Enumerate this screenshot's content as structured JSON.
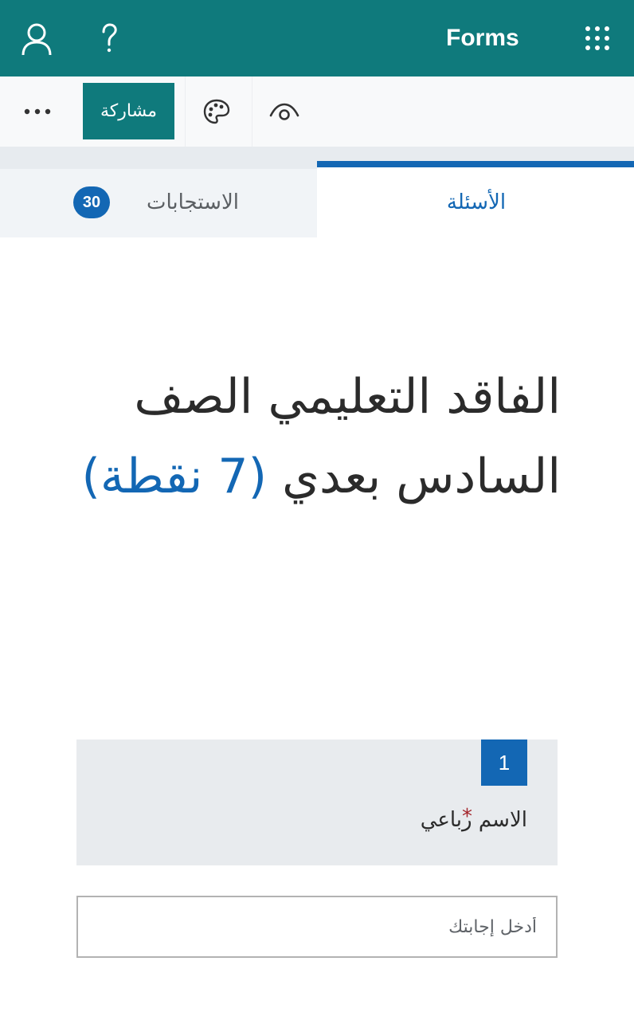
{
  "appbar": {
    "title": "Forms",
    "bg_color": "#0f7a7c",
    "icons": [
      "user-icon",
      "help-icon",
      "waffle-icon"
    ]
  },
  "toolbar": {
    "share_label": "مشاركة",
    "icons": [
      "more-icon",
      "palette-icon",
      "eye-icon"
    ]
  },
  "tabs": {
    "questions_label": "الأسئلة",
    "responses_label": "الاستجابات",
    "responses_count": "30",
    "active": "questions",
    "accent_color": "#1367b4"
  },
  "form": {
    "title_text": "الفاقد التعليمي الصف السادس بعدي",
    "title_points": "(7 نقطة)"
  },
  "questions": [
    {
      "number": "1",
      "text": "الاسم رباعي",
      "required_mark": "*",
      "answer_placeholder": "أدخل إجابتك",
      "answer_value": ""
    }
  ]
}
